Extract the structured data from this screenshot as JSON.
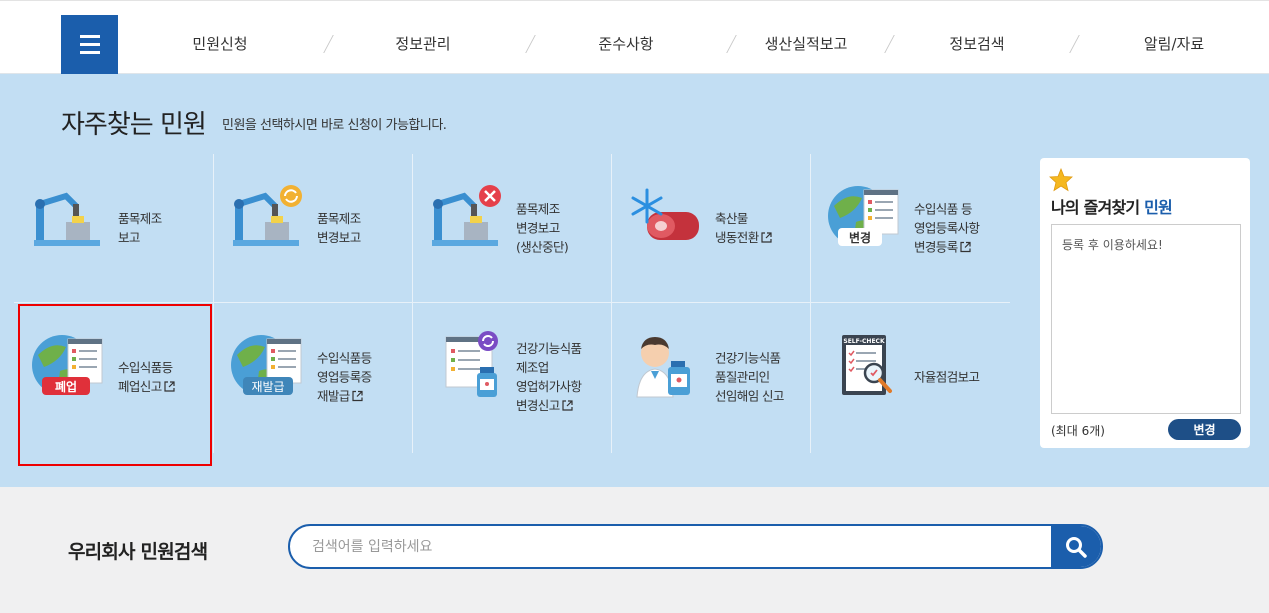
{
  "nav": {
    "menu_icon": "hamburger-icon",
    "items": [
      "민원신청",
      "정보관리",
      "준수사항",
      "생산실적보고",
      "정보검색",
      "알림/자료"
    ]
  },
  "section": {
    "title": "자주찾는 민원",
    "subtitle": "민원을 선택하시면 바로 신청이 가능합니다."
  },
  "tiles": [
    {
      "lines": [
        "품목제조",
        "보고"
      ],
      "icon": "factory-robot-icon",
      "external": false
    },
    {
      "lines": [
        "품목제조",
        "변경보고"
      ],
      "icon": "factory-robot-refresh-icon",
      "external": false
    },
    {
      "lines": [
        "품목제조",
        "변경보고",
        "(생산중단)"
      ],
      "icon": "factory-robot-stop-icon",
      "external": false
    },
    {
      "lines": [
        "축산물",
        "냉동전환"
      ],
      "icon": "frozen-meat-icon",
      "external": true
    },
    {
      "lines": [
        "수입식품 등",
        "영업등록사항",
        "변경등록"
      ],
      "icon": "globe-document-icon",
      "badge": "변경",
      "external": true
    },
    {
      "lines": [
        "수입식품등",
        "폐업신고"
      ],
      "icon": "globe-document-icon",
      "badge": "폐업",
      "external": true
    },
    {
      "lines": [
        "수입식품등",
        "영업등록증",
        "재발급"
      ],
      "icon": "globe-document-icon",
      "badge": "재발급",
      "external": true
    },
    {
      "lines": [
        "건강기능식품",
        "제조업",
        "영업허가사항",
        "변경신고"
      ],
      "icon": "document-bottle-icon",
      "external": true
    },
    {
      "lines": [
        "건강기능식품",
        "품질관리인",
        "선임해임 신고"
      ],
      "icon": "manager-bottle-icon",
      "external": false
    },
    {
      "lines": [
        "자율점검보고"
      ],
      "icon": "self-check-icon",
      "icon_text": "SELF-CHECK",
      "external": false
    }
  ],
  "favorites": {
    "title_prefix": "나의 즐겨찾기",
    "title_highlight": "민원",
    "placeholder": "등록 후 이용하세요!",
    "max_label": "(최대 6개)",
    "change_button": "변경"
  },
  "search": {
    "title": "우리회사 민원검색",
    "placeholder": "검색어를 입력하세요"
  },
  "colors": {
    "primary": "#1b5eac",
    "section_bg": "#c2def3",
    "badge_red": "#e0303a",
    "badge_blue": "#3f86b9",
    "highlight": "#ee0000"
  }
}
